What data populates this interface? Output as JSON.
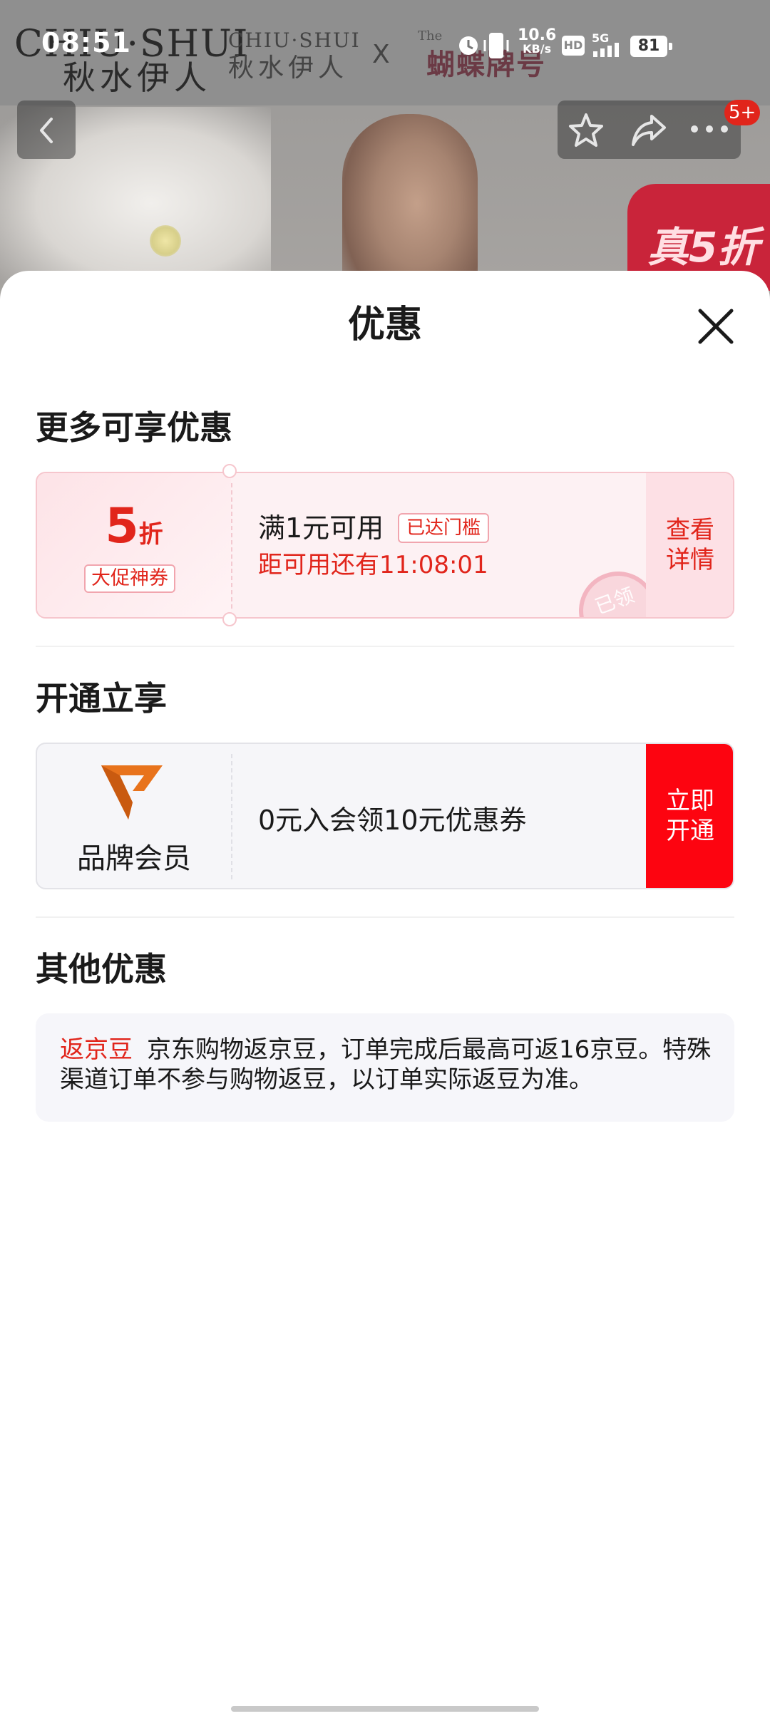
{
  "status_bar": {
    "time": "08:51",
    "speed_value": "10.6",
    "speed_unit": "KB/s",
    "hd": "HD",
    "network": "5G",
    "battery": "81"
  },
  "banner": {
    "brand_en": "CHIU·SHUI",
    "brand_cn": "秋水伊人",
    "co_brand_en": "CHIU·SHUI",
    "co_brand_cn": "秋水伊人",
    "cross": "X",
    "partner_small": "The",
    "partner": "蝴蝶牌号",
    "promo": "真5折"
  },
  "nav": {
    "badge": "5+"
  },
  "sheet": {
    "title": "优惠",
    "sections": {
      "more": "更多可享优惠",
      "open": "开通立享",
      "other": "其他优惠"
    }
  },
  "coupon": {
    "discount_num": "5",
    "discount_unit": "折",
    "tag": "大促神券",
    "condition": "满1元可用",
    "chip": "已达门槛",
    "countdown": "距可用还有11:08:01",
    "stamp": "已领",
    "action": "查看详情"
  },
  "member": {
    "label": "品牌会员",
    "desc": "0元入会领10元优惠券",
    "action": "立即开通"
  },
  "other": {
    "tag": "返京豆",
    "text": "京东购物返京豆，订单完成后最高可返16京豆。特殊渠道订单不参与购物返豆，以订单实际返豆为准。"
  },
  "colors": {
    "accent": "#e1251b",
    "member_button": "#fd0410",
    "member_logo": "#e8731c"
  },
  "icons": [
    "back-icon",
    "star-icon",
    "share-icon",
    "more-icon",
    "close-icon",
    "alarm-icon",
    "vibrate-icon",
    "signal-icon",
    "brand-member-logo-icon"
  ]
}
